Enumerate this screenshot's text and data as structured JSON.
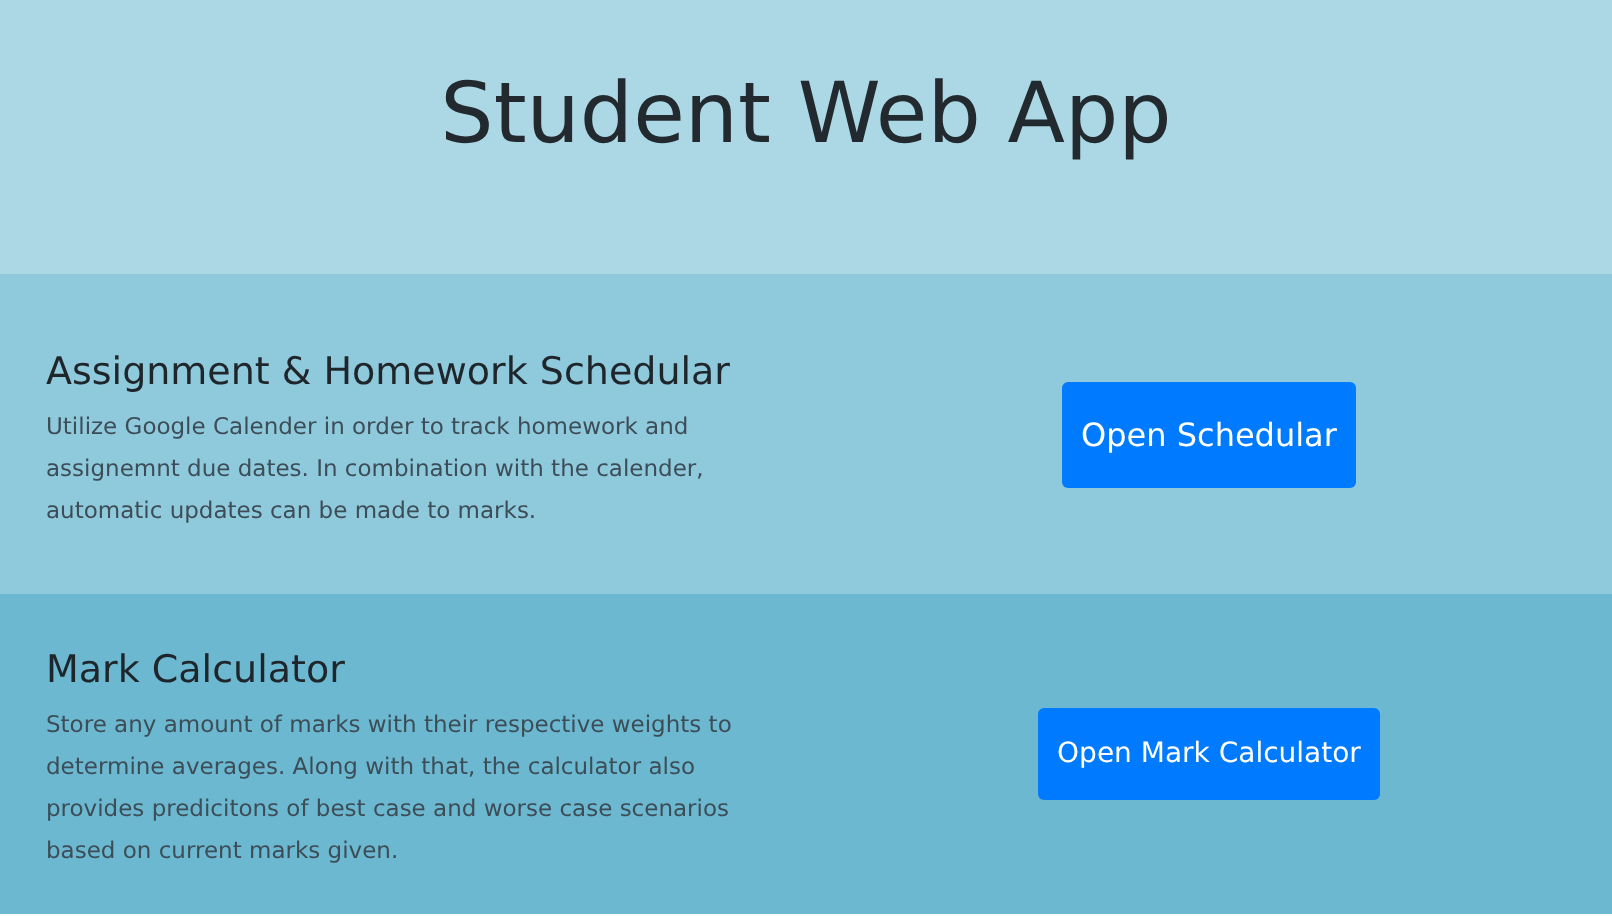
{
  "header": {
    "title": "Student Web App"
  },
  "sections": [
    {
      "heading": "Assignment & Homework Schedular",
      "description": "Utilize Google Calender in order to track homework and assignemnt due dates. In combination with the calender, automatic updates can be made to marks.",
      "button": "Open Schedular",
      "color": "#8fc9dc"
    },
    {
      "heading": "Mark Calculator",
      "description": "Store any amount of marks with their respective weights to determine averages. Along with that, the calculator also provides predicitons of best case and worse case scenarios based on current marks given.",
      "button": "Open Mark Calculator",
      "color": "#6cb8d0"
    }
  ]
}
